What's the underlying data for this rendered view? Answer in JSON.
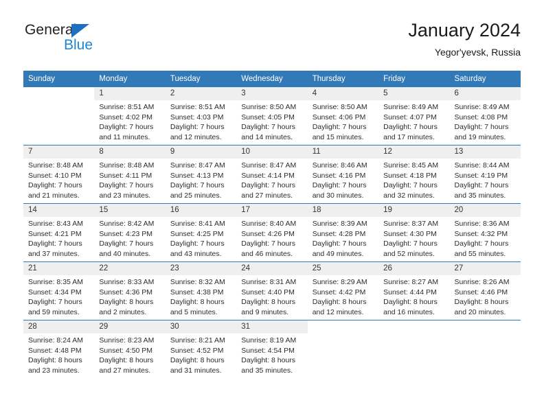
{
  "brand": {
    "name_top": "General",
    "name_bottom": "Blue",
    "triangle_color": "#1e6fc0",
    "blue_color": "#1b86d6"
  },
  "header": {
    "title": "January 2024",
    "subtitle": "Yegor'yevsk, Russia",
    "header_bg": "#3279b8",
    "daynum_bg": "#efefef"
  },
  "weekday_headers": [
    "Sunday",
    "Monday",
    "Tuesday",
    "Wednesday",
    "Thursday",
    "Friday",
    "Saturday"
  ],
  "weeks": [
    [
      {
        "day": "",
        "lines": []
      },
      {
        "day": "1",
        "lines": [
          "Sunrise: 8:51 AM",
          "Sunset: 4:02 PM",
          "Daylight: 7 hours",
          "and 11 minutes."
        ]
      },
      {
        "day": "2",
        "lines": [
          "Sunrise: 8:51 AM",
          "Sunset: 4:03 PM",
          "Daylight: 7 hours",
          "and 12 minutes."
        ]
      },
      {
        "day": "3",
        "lines": [
          "Sunrise: 8:50 AM",
          "Sunset: 4:05 PM",
          "Daylight: 7 hours",
          "and 14 minutes."
        ]
      },
      {
        "day": "4",
        "lines": [
          "Sunrise: 8:50 AM",
          "Sunset: 4:06 PM",
          "Daylight: 7 hours",
          "and 15 minutes."
        ]
      },
      {
        "day": "5",
        "lines": [
          "Sunrise: 8:49 AM",
          "Sunset: 4:07 PM",
          "Daylight: 7 hours",
          "and 17 minutes."
        ]
      },
      {
        "day": "6",
        "lines": [
          "Sunrise: 8:49 AM",
          "Sunset: 4:08 PM",
          "Daylight: 7 hours",
          "and 19 minutes."
        ]
      }
    ],
    [
      {
        "day": "7",
        "lines": [
          "Sunrise: 8:48 AM",
          "Sunset: 4:10 PM",
          "Daylight: 7 hours",
          "and 21 minutes."
        ]
      },
      {
        "day": "8",
        "lines": [
          "Sunrise: 8:48 AM",
          "Sunset: 4:11 PM",
          "Daylight: 7 hours",
          "and 23 minutes."
        ]
      },
      {
        "day": "9",
        "lines": [
          "Sunrise: 8:47 AM",
          "Sunset: 4:13 PM",
          "Daylight: 7 hours",
          "and 25 minutes."
        ]
      },
      {
        "day": "10",
        "lines": [
          "Sunrise: 8:47 AM",
          "Sunset: 4:14 PM",
          "Daylight: 7 hours",
          "and 27 minutes."
        ]
      },
      {
        "day": "11",
        "lines": [
          "Sunrise: 8:46 AM",
          "Sunset: 4:16 PM",
          "Daylight: 7 hours",
          "and 30 minutes."
        ]
      },
      {
        "day": "12",
        "lines": [
          "Sunrise: 8:45 AM",
          "Sunset: 4:18 PM",
          "Daylight: 7 hours",
          "and 32 minutes."
        ]
      },
      {
        "day": "13",
        "lines": [
          "Sunrise: 8:44 AM",
          "Sunset: 4:19 PM",
          "Daylight: 7 hours",
          "and 35 minutes."
        ]
      }
    ],
    [
      {
        "day": "14",
        "lines": [
          "Sunrise: 8:43 AM",
          "Sunset: 4:21 PM",
          "Daylight: 7 hours",
          "and 37 minutes."
        ]
      },
      {
        "day": "15",
        "lines": [
          "Sunrise: 8:42 AM",
          "Sunset: 4:23 PM",
          "Daylight: 7 hours",
          "and 40 minutes."
        ]
      },
      {
        "day": "16",
        "lines": [
          "Sunrise: 8:41 AM",
          "Sunset: 4:25 PM",
          "Daylight: 7 hours",
          "and 43 minutes."
        ]
      },
      {
        "day": "17",
        "lines": [
          "Sunrise: 8:40 AM",
          "Sunset: 4:26 PM",
          "Daylight: 7 hours",
          "and 46 minutes."
        ]
      },
      {
        "day": "18",
        "lines": [
          "Sunrise: 8:39 AM",
          "Sunset: 4:28 PM",
          "Daylight: 7 hours",
          "and 49 minutes."
        ]
      },
      {
        "day": "19",
        "lines": [
          "Sunrise: 8:37 AM",
          "Sunset: 4:30 PM",
          "Daylight: 7 hours",
          "and 52 minutes."
        ]
      },
      {
        "day": "20",
        "lines": [
          "Sunrise: 8:36 AM",
          "Sunset: 4:32 PM",
          "Daylight: 7 hours",
          "and 55 minutes."
        ]
      }
    ],
    [
      {
        "day": "21",
        "lines": [
          "Sunrise: 8:35 AM",
          "Sunset: 4:34 PM",
          "Daylight: 7 hours",
          "and 59 minutes."
        ]
      },
      {
        "day": "22",
        "lines": [
          "Sunrise: 8:33 AM",
          "Sunset: 4:36 PM",
          "Daylight: 8 hours",
          "and 2 minutes."
        ]
      },
      {
        "day": "23",
        "lines": [
          "Sunrise: 8:32 AM",
          "Sunset: 4:38 PM",
          "Daylight: 8 hours",
          "and 5 minutes."
        ]
      },
      {
        "day": "24",
        "lines": [
          "Sunrise: 8:31 AM",
          "Sunset: 4:40 PM",
          "Daylight: 8 hours",
          "and 9 minutes."
        ]
      },
      {
        "day": "25",
        "lines": [
          "Sunrise: 8:29 AM",
          "Sunset: 4:42 PM",
          "Daylight: 8 hours",
          "and 12 minutes."
        ]
      },
      {
        "day": "26",
        "lines": [
          "Sunrise: 8:27 AM",
          "Sunset: 4:44 PM",
          "Daylight: 8 hours",
          "and 16 minutes."
        ]
      },
      {
        "day": "27",
        "lines": [
          "Sunrise: 8:26 AM",
          "Sunset: 4:46 PM",
          "Daylight: 8 hours",
          "and 20 minutes."
        ]
      }
    ],
    [
      {
        "day": "28",
        "lines": [
          "Sunrise: 8:24 AM",
          "Sunset: 4:48 PM",
          "Daylight: 8 hours",
          "and 23 minutes."
        ]
      },
      {
        "day": "29",
        "lines": [
          "Sunrise: 8:23 AM",
          "Sunset: 4:50 PM",
          "Daylight: 8 hours",
          "and 27 minutes."
        ]
      },
      {
        "day": "30",
        "lines": [
          "Sunrise: 8:21 AM",
          "Sunset: 4:52 PM",
          "Daylight: 8 hours",
          "and 31 minutes."
        ]
      },
      {
        "day": "31",
        "lines": [
          "Sunrise: 8:19 AM",
          "Sunset: 4:54 PM",
          "Daylight: 8 hours",
          "and 35 minutes."
        ]
      },
      {
        "day": "",
        "lines": []
      },
      {
        "day": "",
        "lines": []
      },
      {
        "day": "",
        "lines": []
      }
    ]
  ]
}
